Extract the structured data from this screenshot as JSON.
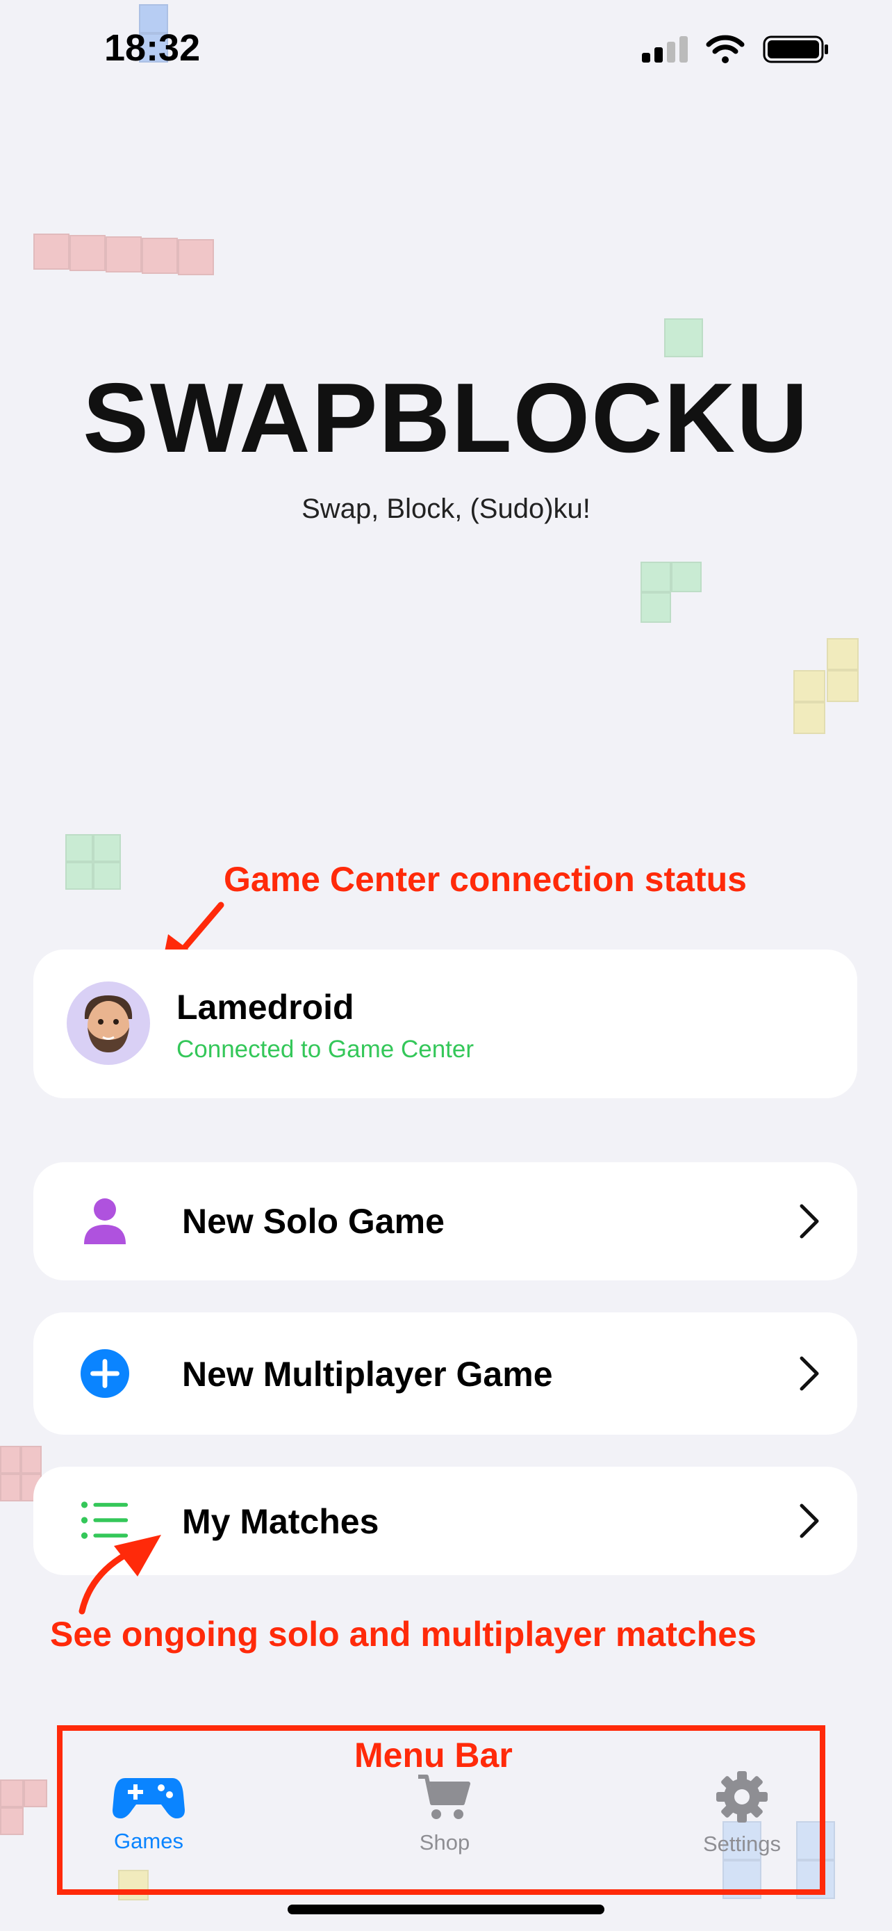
{
  "status_bar": {
    "time": "18:32"
  },
  "header": {
    "title": "SWAPBLOCKU",
    "subtitle": "Swap, Block, (Sudo)ku!"
  },
  "profile": {
    "name": "Lamedroid",
    "status": "Connected to Game Center",
    "status_color": "#34c759"
  },
  "menu": {
    "items": [
      {
        "label": "New Solo Game",
        "icon": "person-icon",
        "color": "#af52de"
      },
      {
        "label": "New Multiplayer Game",
        "icon": "plus-circle-icon",
        "color": "#0a84ff"
      },
      {
        "label": "My Matches",
        "icon": "list-icon",
        "color": "#34c759"
      }
    ]
  },
  "annotations": {
    "gamecenter": "Game Center connection status",
    "matches": "See ongoing solo and multiplayer matches",
    "menubar": "Menu Bar"
  },
  "tabbar": {
    "tabs": [
      {
        "label": "Games",
        "icon": "gamecontroller-icon",
        "active": true
      },
      {
        "label": "Shop",
        "icon": "cart-icon",
        "active": false
      },
      {
        "label": "Settings",
        "icon": "gear-icon",
        "active": false
      }
    ],
    "active_color": "#0a84ff",
    "inactive_color": "#8e8e93"
  },
  "accent_color": "#ff2a0a"
}
